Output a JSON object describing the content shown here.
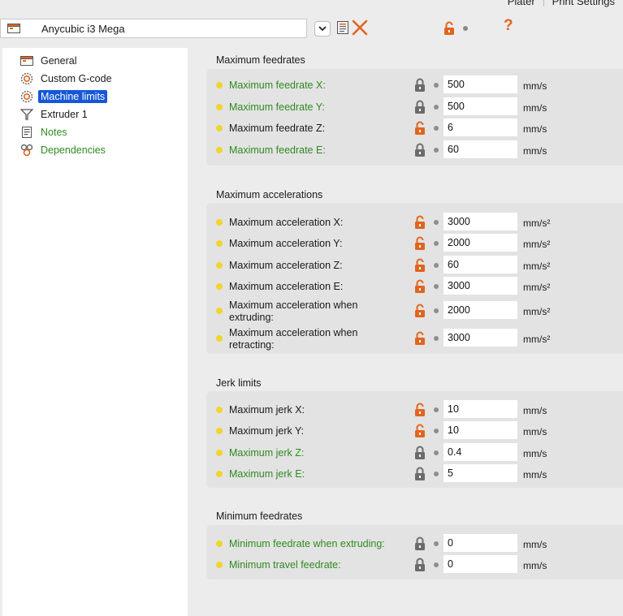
{
  "tabs": [
    "Plater",
    "Print Settings"
  ],
  "preset": {
    "name": "Anycubic i3 Mega"
  },
  "help_symbol": "?",
  "colors": {
    "accent": "#e0651f",
    "system_value": "#2f8a1f",
    "selected": "#1557d6",
    "bullet": "#f1d52c"
  },
  "sidebar": {
    "items": [
      {
        "label": "General",
        "icon": "printer-icon",
        "selected": false,
        "modified": false
      },
      {
        "label": "Custom G-code",
        "icon": "gcode-icon",
        "selected": false,
        "modified": false
      },
      {
        "label": "Machine limits",
        "icon": "gear-icon",
        "selected": true,
        "modified": false
      },
      {
        "label": "Extruder 1",
        "icon": "extruder-icon",
        "selected": false,
        "modified": false
      },
      {
        "label": "Notes",
        "icon": "notes-icon",
        "selected": false,
        "modified": true
      },
      {
        "label": "Dependencies",
        "icon": "dependencies-icon",
        "selected": false,
        "modified": true
      }
    ]
  },
  "sections": [
    {
      "title": "Maximum feedrates",
      "rows": [
        {
          "label": "Maximum feedrate X:",
          "value": "500",
          "unit": "mm/s",
          "locked": true
        },
        {
          "label": "Maximum feedrate Y:",
          "value": "500",
          "unit": "mm/s",
          "locked": true
        },
        {
          "label": "Maximum feedrate Z:",
          "value": "6",
          "unit": "mm/s",
          "locked": false
        },
        {
          "label": "Maximum feedrate E:",
          "value": "60",
          "unit": "mm/s",
          "locked": true
        }
      ]
    },
    {
      "title": "Maximum accelerations",
      "rows": [
        {
          "label": "Maximum acceleration X:",
          "value": "3000",
          "unit": "mm/s²",
          "locked": false
        },
        {
          "label": "Maximum acceleration Y:",
          "value": "2000",
          "unit": "mm/s²",
          "locked": false
        },
        {
          "label": "Maximum acceleration Z:",
          "value": "60",
          "unit": "mm/s²",
          "locked": false
        },
        {
          "label": "Maximum acceleration E:",
          "value": "3000",
          "unit": "mm/s²",
          "locked": false
        },
        {
          "label": "Maximum acceleration when extruding:",
          "value": "2000",
          "unit": "mm/s²",
          "locked": false
        },
        {
          "label": "Maximum acceleration when retracting:",
          "value": "3000",
          "unit": "mm/s²",
          "locked": false
        }
      ]
    },
    {
      "title": "Jerk limits",
      "rows": [
        {
          "label": "Maximum jerk X:",
          "value": "10",
          "unit": "mm/s",
          "locked": false
        },
        {
          "label": "Maximum jerk Y:",
          "value": "10",
          "unit": "mm/s",
          "locked": false
        },
        {
          "label": "Maximum jerk Z:",
          "value": "0.4",
          "unit": "mm/s",
          "locked": true
        },
        {
          "label": "Maximum jerk E:",
          "value": "5",
          "unit": "mm/s",
          "locked": true
        }
      ]
    },
    {
      "title": "Minimum feedrates",
      "rows": [
        {
          "label": "Minimum feedrate when extruding:",
          "value": "0",
          "unit": "mm/s",
          "locked": true
        },
        {
          "label": "Minimum travel feedrate:",
          "value": "0",
          "unit": "mm/s",
          "locked": true
        }
      ]
    }
  ]
}
